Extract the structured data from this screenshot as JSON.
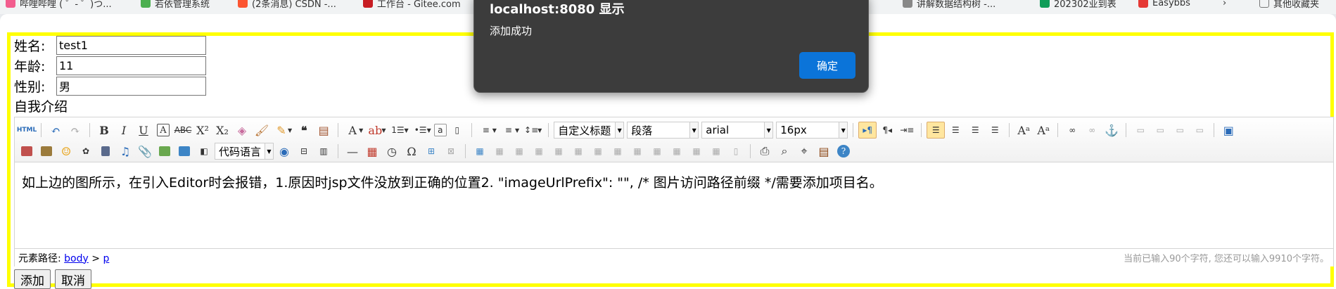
{
  "bookmarks": [
    {
      "label": "哔哩哔哩 ( ゜- ゜)つ...",
      "color": "#f25d8e"
    },
    {
      "label": "若依管理系统",
      "color": "#4caf50"
    },
    {
      "label": "(2条消息) CSDN -...",
      "color": "#fc5531"
    },
    {
      "label": "工作台 - Gitee.com",
      "color": "#c71d23"
    },
    {
      "label": "讲解数据结构树 -...",
      "color": "#888888"
    },
    {
      "label": "202302业到表",
      "color": "#0f9d58"
    },
    {
      "label": "Easybbs",
      "color": "#e53935"
    },
    {
      "label": "其他收藏夹",
      "color": "#777777"
    }
  ],
  "form": {
    "name_label": "姓名:",
    "name_value": "test1",
    "age_label": "年龄:",
    "age_value": "11",
    "gender_label": "性别:",
    "gender_value": "男",
    "intro_label": "自我介绍"
  },
  "editor": {
    "combo_code": "代码语言",
    "combo_heading": "自定义标题",
    "combo_paragraph": "段落",
    "combo_font": "arial",
    "combo_size": "16px",
    "content_text": "如上边的图所示，在引入Editor时会报错，1.原因时jsp文件没放到正确的位置2. \"imageUrlPrefix\": \"\", /* 图片访问路径前缀 */需要添加项目名。",
    "path_label": "元素路径: ",
    "path_body": "body",
    "path_sep": " > ",
    "path_p": "p",
    "char_count": "当前已输入90个字符, 您还可以输入9910个字符。"
  },
  "buttons": {
    "add": "添加",
    "cancel": "取消"
  },
  "dialog": {
    "title": "localhost:8080 显示",
    "message": "添加成功",
    "ok": "确定"
  }
}
